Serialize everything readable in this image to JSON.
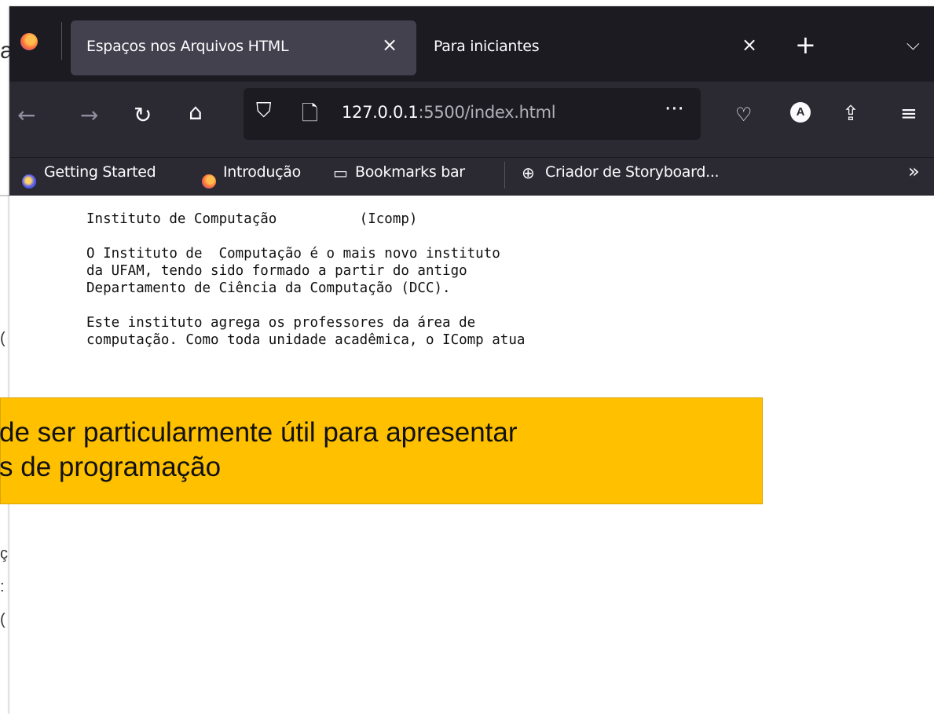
{
  "browser": {
    "tabs": [
      {
        "title": "Espaços nos Arquivos HTML",
        "active": true
      },
      {
        "title": "Para iniciantes",
        "active": false
      }
    ],
    "new_tab_symbol": "+",
    "close_symbol": "×",
    "tab_list_symbol": "⌵",
    "url": {
      "host": "127.0.0.1",
      "rest": ":5500/index.html"
    },
    "toolbar_icons": [
      "back-icon",
      "forward-icon",
      "reload-icon",
      "home-icon",
      "shield-icon",
      "page-icon",
      "more-icon",
      "pocket-icon",
      "account-icon",
      "share-icon",
      "menu-icon"
    ],
    "account_initial": "A",
    "more_symbol": "···",
    "overflow_symbol": "»",
    "bookmarks": [
      {
        "label": "Getting Started",
        "icon": "firefox-blue-icon"
      },
      {
        "label": "Introdução",
        "icon": "firefox-icon"
      },
      {
        "label": "Bookmarks bar",
        "icon": "folder-icon"
      },
      {
        "label": "Criador de Storyboard...",
        "icon": "globe-icon"
      }
    ]
  },
  "page": {
    "heading_line": "Instituto de Computação          (Icomp)",
    "paragraph1": [
      "O Instituto de  Computação é o mais novo instituto",
      "da UFAM, tendo sido formado a partir do antigo",
      "Departamento de Ciência da Computação (DCC)."
    ],
    "paragraph2": [
      "Este instituto agrega os professores da área de",
      "computação. Como toda unidade acadêmica, o IComp atua"
    ]
  },
  "slide": {
    "callout_lines": [
      "de ser particularmente útil para apresentar",
      "s de programação"
    ],
    "left_fragments": [
      "a",
      "(",
      "ç",
      ":",
      "("
    ]
  },
  "colors": {
    "tabbar": "#1c1b22",
    "toolbar": "#2b2a33",
    "callout": "#ffc000"
  }
}
